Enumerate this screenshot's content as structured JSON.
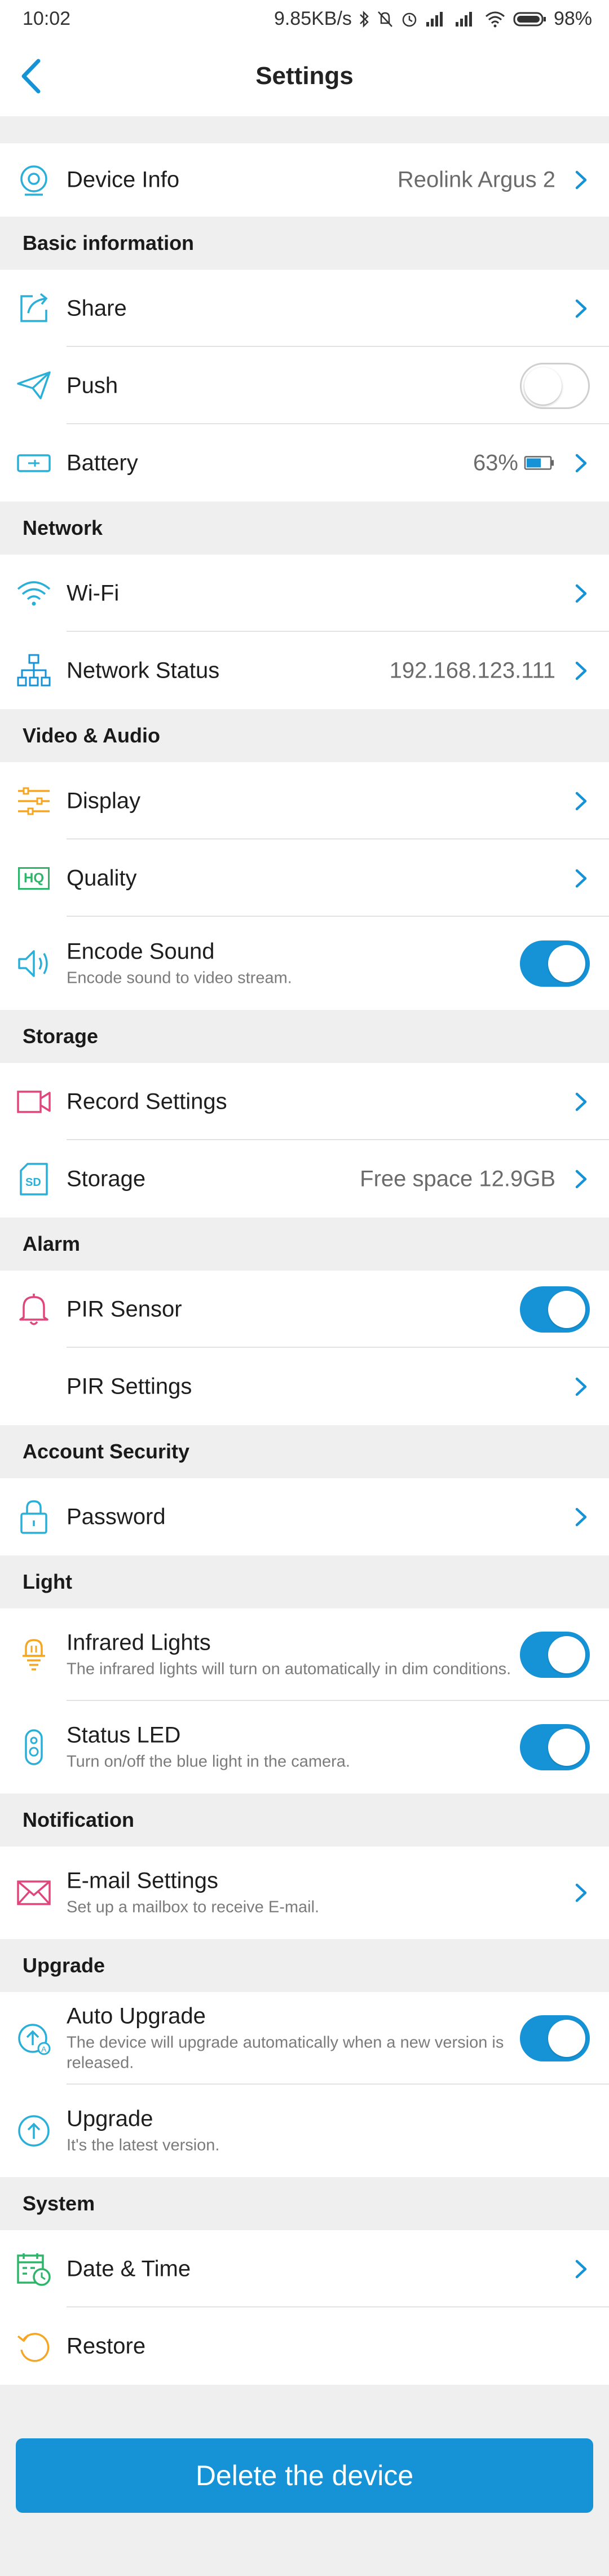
{
  "status_bar": {
    "time": "10:02",
    "net_speed": "9.85KB/s",
    "battery_pct": "98%"
  },
  "nav": {
    "title": "Settings"
  },
  "device_info": {
    "label": "Device Info",
    "value": "Reolink Argus 2"
  },
  "sections": {
    "basic": "Basic information",
    "network": "Network",
    "video_audio": "Video & Audio",
    "storage": "Storage",
    "alarm": "Alarm",
    "account": "Account Security",
    "light": "Light",
    "notification": "Notification",
    "upgrade": "Upgrade",
    "system": "System"
  },
  "items": {
    "share": {
      "label": "Share"
    },
    "push": {
      "label": "Push",
      "on": false
    },
    "battery": {
      "label": "Battery",
      "value": "63%",
      "level": 0.63
    },
    "wifi": {
      "label": "Wi-Fi"
    },
    "network_status": {
      "label": "Network Status",
      "value": "192.168.123.111"
    },
    "display": {
      "label": "Display"
    },
    "quality": {
      "label": "Quality",
      "badge": "HQ"
    },
    "encode_sound": {
      "label": "Encode Sound",
      "sub": "Encode sound to video stream.",
      "on": true
    },
    "record_settings": {
      "label": "Record Settings"
    },
    "storage": {
      "label": "Storage",
      "value": "Free space 12.9GB",
      "badge": "SD"
    },
    "pir_sensor": {
      "label": "PIR Sensor",
      "on": true
    },
    "pir_settings": {
      "label": "PIR Settings"
    },
    "password": {
      "label": "Password"
    },
    "infrared": {
      "label": "Infrared Lights",
      "sub": "The infrared lights will turn on automatically in dim conditions.",
      "on": true
    },
    "status_led": {
      "label": "Status LED",
      "sub": "Turn on/off the blue light in the camera.",
      "on": true
    },
    "email": {
      "label": "E-mail Settings",
      "sub": "Set up a mailbox to receive E-mail."
    },
    "auto_upgrade": {
      "label": "Auto Upgrade",
      "sub": "The device will upgrade automatically when a new version is released.",
      "on": true
    },
    "upgrade": {
      "label": "Upgrade",
      "sub": "It's the latest version."
    },
    "date_time": {
      "label": "Date & Time"
    },
    "restore": {
      "label": "Restore"
    }
  },
  "delete_button": "Delete the device",
  "colors": {
    "accent": "#1593d6",
    "teal_icon": "#2ab0d8",
    "orange_icon": "#f5a623",
    "pink_icon": "#e0467c",
    "green_icon": "#2fb56a",
    "section_bg": "#efefef"
  }
}
